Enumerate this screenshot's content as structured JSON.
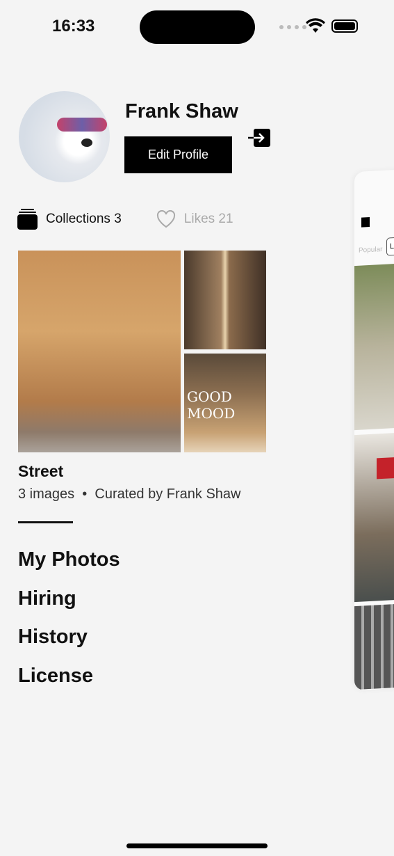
{
  "status_bar": {
    "time": "16:33"
  },
  "profile": {
    "name": "Frank Shaw",
    "edit_label": "Edit Profile"
  },
  "stats": {
    "collections": "Collections 3",
    "likes": "Likes 21"
  },
  "collection": {
    "title": "Street",
    "count": "3 images",
    "curator": "Curated by Frank Shaw",
    "overlay_text": "GOOD MOOD"
  },
  "menu": [
    "My Photos",
    "Hiring",
    "History",
    "License"
  ],
  "side_panel": {
    "tab_popular": "Popular",
    "tab_latest": "La"
  }
}
